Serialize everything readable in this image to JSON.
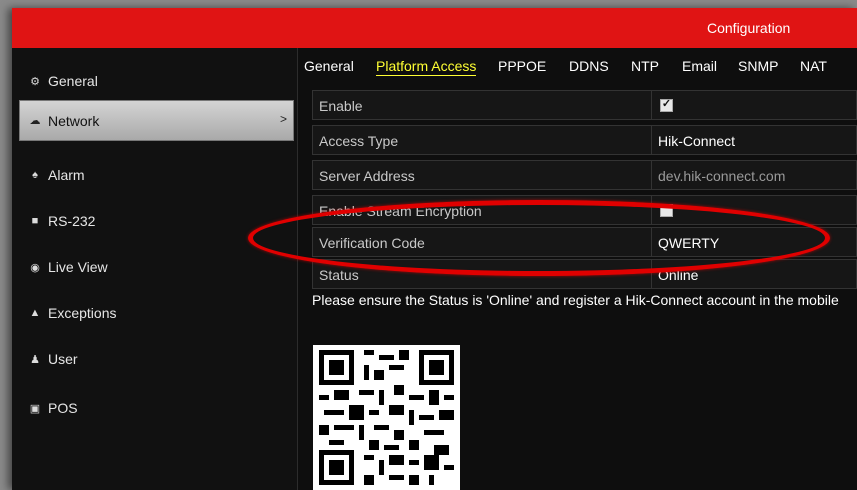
{
  "window": {
    "title": "Configuration"
  },
  "sidebar": {
    "items": [
      {
        "label": "General",
        "icon": "gear-icon"
      },
      {
        "label": "Network",
        "icon": "network-icon",
        "active": true
      },
      {
        "label": "Alarm",
        "icon": "alarm-icon"
      },
      {
        "label": "RS-232",
        "icon": "rs232-icon"
      },
      {
        "label": "Live View",
        "icon": "eye-icon"
      },
      {
        "label": "Exceptions",
        "icon": "warning-icon"
      },
      {
        "label": "User",
        "icon": "users-icon"
      },
      {
        "label": "POS",
        "icon": "pos-icon"
      }
    ],
    "active_chevron": ">"
  },
  "tabs": [
    {
      "label": "General"
    },
    {
      "label": "Platform Access",
      "active": true
    },
    {
      "label": "PPPOE"
    },
    {
      "label": "DDNS"
    },
    {
      "label": "NTP"
    },
    {
      "label": "Email"
    },
    {
      "label": "SNMP"
    },
    {
      "label": "NAT"
    }
  ],
  "form": {
    "enable": {
      "label": "Enable",
      "checked": true
    },
    "access_type": {
      "label": "Access Type",
      "value": "Hik-Connect"
    },
    "server_address": {
      "label": "Server Address",
      "value": "dev.hik-connect.com"
    },
    "stream_encryption": {
      "label": "Enable Stream Encryption",
      "checked": false
    },
    "verification_code": {
      "label": "Verification Code",
      "value": "QWERTY"
    },
    "status": {
      "label": "Status",
      "value": "Online"
    }
  },
  "note": "Please ensure the Status is 'Online' and register a Hik-Connect account in the mobile",
  "colors": {
    "titlebar": "#e01414",
    "active_tab": "#ffff33",
    "highlight": "#e00000"
  }
}
